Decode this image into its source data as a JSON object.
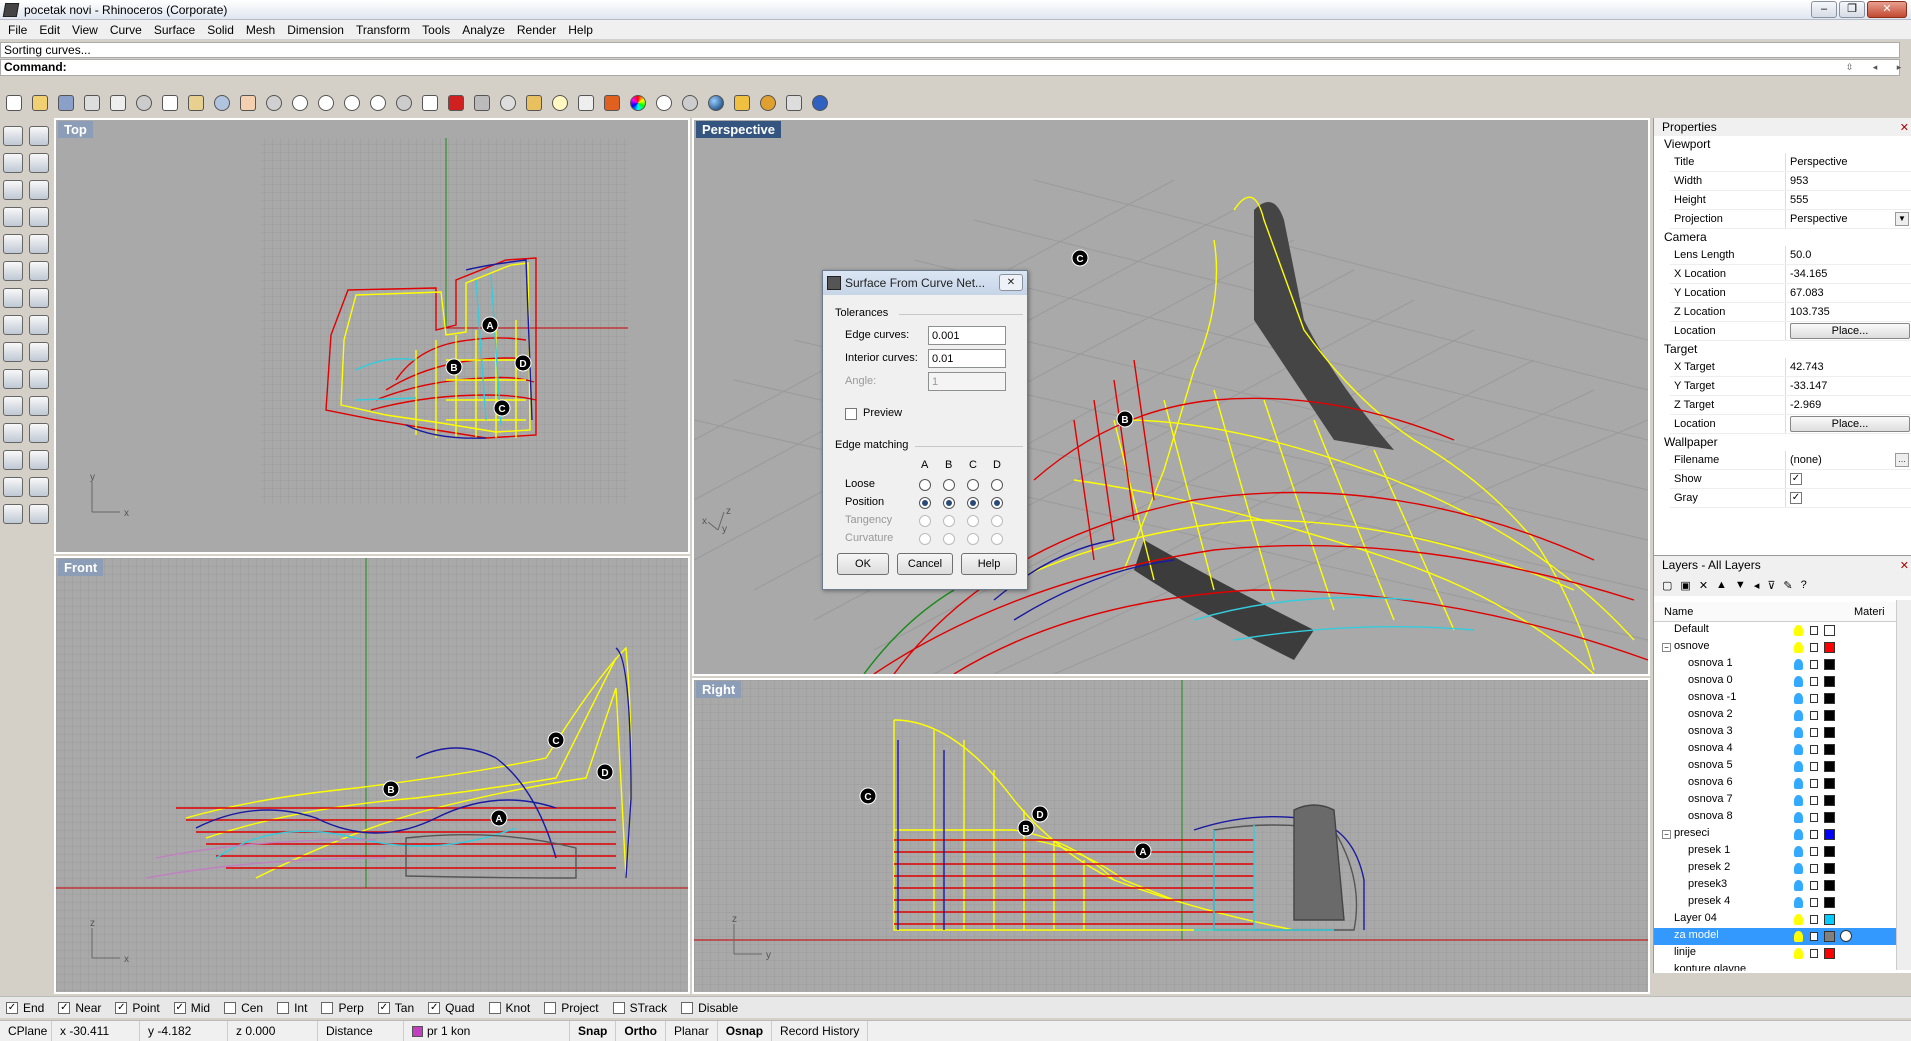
{
  "window": {
    "title": "pocetak novi - Rhinoceros (Corporate)",
    "buttons": [
      "–",
      "❐",
      "✕"
    ]
  },
  "menu": [
    "File",
    "Edit",
    "View",
    "Curve",
    "Surface",
    "Solid",
    "Mesh",
    "Dimension",
    "Transform",
    "Tools",
    "Analyze",
    "Render",
    "Help"
  ],
  "command": {
    "history": "Sorting curves...",
    "prompt": "Command:",
    "value": ""
  },
  "viewports": {
    "top": "Top",
    "perspective": "Perspective",
    "front": "Front",
    "right": "Right"
  },
  "axis_labels": {
    "x": "x",
    "y": "y",
    "z": "z"
  },
  "markers": {
    "a": "A",
    "b": "B",
    "c": "C",
    "d": "D"
  },
  "dialog": {
    "title": "Surface From Curve Net...",
    "close": "✕",
    "tolerances": "Tolerances",
    "edge_curves_label": "Edge curves:",
    "edge_curves_value": "0.001",
    "interior_curves_label": "Interior curves:",
    "interior_curves_value": "0.01",
    "angle_label": "Angle:",
    "angle_value": "1",
    "preview_label": "Preview",
    "edge_matching": "Edge matching",
    "cols": [
      "A",
      "B",
      "C",
      "D"
    ],
    "rows": [
      "Loose",
      "Position",
      "Tangency",
      "Curvature"
    ],
    "ok": "OK",
    "cancel": "Cancel",
    "help": "Help"
  },
  "properties": {
    "header": "Properties",
    "viewport_group": "Viewport",
    "title_k": "Title",
    "title_v": "Perspective",
    "width_k": "Width",
    "width_v": "953",
    "height_k": "Height",
    "height_v": "555",
    "projection_k": "Projection",
    "projection_v": "Perspective",
    "camera_group": "Camera",
    "lens_k": "Lens Length",
    "lens_v": "50.0",
    "xloc_k": "X Location",
    "xloc_v": "-34.165",
    "yloc_k": "Y Location",
    "yloc_v": "67.083",
    "zloc_k": "Z Location",
    "zloc_v": "103.735",
    "location_k": "Location",
    "place": "Place...",
    "target_group": "Target",
    "xt_k": "X Target",
    "xt_v": "42.743",
    "yt_k": "Y Target",
    "yt_v": "-33.147",
    "zt_k": "Z Target",
    "zt_v": "-2.969",
    "wallpaper_group": "Wallpaper",
    "filename_k": "Filename",
    "filename_v": "(none)",
    "show_k": "Show",
    "gray_k": "Gray"
  },
  "layers": {
    "header": "Layers - All Layers",
    "col_name": "Name",
    "col_material": "Materi",
    "rows": [
      {
        "name": "Default",
        "color": "#000000"
      },
      {
        "name": "osnove",
        "color": "#ff0000"
      },
      {
        "name": "osnova 1",
        "color": "#000000"
      },
      {
        "name": "osnova 0",
        "color": "#000000"
      },
      {
        "name": "osnova -1",
        "color": "#000000"
      },
      {
        "name": "osnova 2",
        "color": "#000000"
      },
      {
        "name": "osnova 3",
        "color": "#000000"
      },
      {
        "name": "osnova 4",
        "color": "#000000"
      },
      {
        "name": "osnova 5",
        "color": "#000000"
      },
      {
        "name": "osnova 6",
        "color": "#000000"
      },
      {
        "name": "osnova 7",
        "color": "#000000"
      },
      {
        "name": "osnova 8",
        "color": "#000000"
      },
      {
        "name": "preseci",
        "color": "#0000ff"
      },
      {
        "name": "presek 1",
        "color": "#000000"
      },
      {
        "name": "presek 2",
        "color": "#000000"
      },
      {
        "name": "presek3",
        "color": "#000000"
      },
      {
        "name": "presek 4",
        "color": "#000000"
      },
      {
        "name": "Layer 04",
        "color": "#00ccff"
      },
      {
        "name": "za model",
        "color": "#808080"
      },
      {
        "name": "linije",
        "color": "#ff0000"
      },
      {
        "name": "konture glavne",
        "color": "#00aa00"
      }
    ]
  },
  "osnap": [
    {
      "label": "End",
      "checked": true
    },
    {
      "label": "Near",
      "checked": true
    },
    {
      "label": "Point",
      "checked": true
    },
    {
      "label": "Mid",
      "checked": true
    },
    {
      "label": "Cen",
      "checked": false
    },
    {
      "label": "Int",
      "checked": false
    },
    {
      "label": "Perp",
      "checked": false
    },
    {
      "label": "Tan",
      "checked": true
    },
    {
      "label": "Quad",
      "checked": true
    },
    {
      "label": "Knot",
      "checked": false
    },
    {
      "label": "Project",
      "checked": false
    },
    {
      "label": "STrack",
      "checked": false
    },
    {
      "label": "Disable",
      "checked": false
    }
  ],
  "status": {
    "cplane": "CPlane",
    "x": "x -30.411",
    "y": "y -4.182",
    "z": "z 0.000",
    "distance": "Distance",
    "layer": "pr 1 kon",
    "snap": "Snap",
    "ortho": "Ortho",
    "planar": "Planar",
    "osnap": "Osnap",
    "record": "Record History"
  },
  "colors": {
    "viewport_bg": "#a9a9a9",
    "curve_red": "#e00000",
    "curve_yellow": "#ffff00",
    "curve_blue": "#1a1aa0",
    "curve_cyan": "#33ccdd",
    "selection": "#3399ff"
  }
}
